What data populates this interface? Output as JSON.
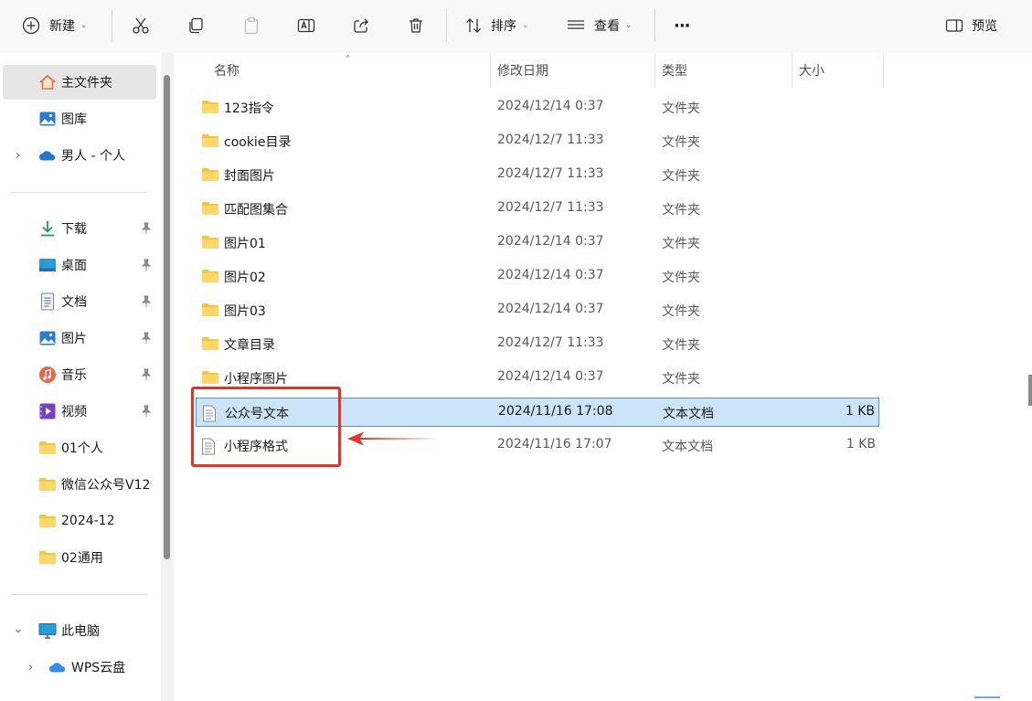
{
  "toolbar": {
    "new_label": "新建",
    "sort_label": "排序",
    "view_label": "查看",
    "more_label": "···",
    "preview_label": "预览"
  },
  "sidebar": {
    "items": [
      {
        "label": "主文件夹",
        "icon": "home-icon"
      },
      {
        "label": "图库",
        "icon": "gallery-icon"
      },
      {
        "label": "男人 - 个人",
        "icon": "onedrive-cloud-icon"
      },
      {
        "label": "下载",
        "icon": "download-icon"
      },
      {
        "label": "桌面",
        "icon": "desktop-icon"
      },
      {
        "label": "文档",
        "icon": "document-icon"
      },
      {
        "label": "图片",
        "icon": "pictures-icon"
      },
      {
        "label": "音乐",
        "icon": "music-icon"
      },
      {
        "label": "视频",
        "icon": "video-icon"
      },
      {
        "label": "01个人",
        "icon": "folder-icon"
      },
      {
        "label": "微信公众号V12",
        "icon": "folder-icon"
      },
      {
        "label": "2024-12",
        "icon": "folder-icon"
      },
      {
        "label": "02通用",
        "icon": "folder-icon"
      },
      {
        "label": "此电脑",
        "icon": "this-pc-icon"
      },
      {
        "label": "WPS云盘",
        "icon": "wps-cloud-icon"
      }
    ]
  },
  "columns": {
    "name": "名称",
    "modified": "修改日期",
    "type": "类型",
    "size": "大小"
  },
  "files": [
    {
      "name": "123指令",
      "modified": "2024/12/14 0:37",
      "type": "文件夹",
      "size": "",
      "kind": "folder"
    },
    {
      "name": "cookie目录",
      "modified": "2024/12/7 11:33",
      "type": "文件夹",
      "size": "",
      "kind": "folder"
    },
    {
      "name": "封面图片",
      "modified": "2024/12/7 11:33",
      "type": "文件夹",
      "size": "",
      "kind": "folder"
    },
    {
      "name": "匹配图集合",
      "modified": "2024/12/7 11:33",
      "type": "文件夹",
      "size": "",
      "kind": "folder"
    },
    {
      "name": "图片01",
      "modified": "2024/12/14 0:37",
      "type": "文件夹",
      "size": "",
      "kind": "folder"
    },
    {
      "name": "图片02",
      "modified": "2024/12/14 0:37",
      "type": "文件夹",
      "size": "",
      "kind": "folder"
    },
    {
      "name": "图片03",
      "modified": "2024/12/14 0:37",
      "type": "文件夹",
      "size": "",
      "kind": "folder"
    },
    {
      "name": "文章目录",
      "modified": "2024/12/7 11:33",
      "type": "文件夹",
      "size": "",
      "kind": "folder"
    },
    {
      "name": "小程序图片",
      "modified": "2024/12/14 0:37",
      "type": "文件夹",
      "size": "",
      "kind": "folder"
    },
    {
      "name": "公众号文本",
      "modified": "2024/11/16 17:08",
      "type": "文本文档",
      "size": "1 KB",
      "kind": "text"
    },
    {
      "name": "小程序格式",
      "modified": "2024/11/16 17:07",
      "type": "文本文档",
      "size": "1 KB",
      "kind": "text"
    }
  ],
  "selected_file": "公众号文本",
  "annotation_color": "#e5332a",
  "selection_color": "#cce4f7"
}
